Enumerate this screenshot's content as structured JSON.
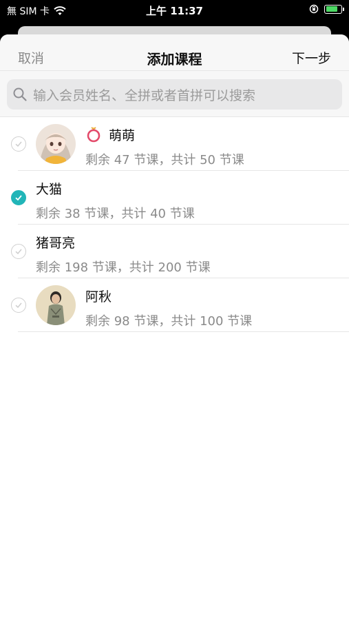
{
  "status_bar": {
    "carrier": "無 SIM 卡",
    "time": "上午 11:37"
  },
  "nav": {
    "cancel": "取消",
    "title": "添加课程",
    "next": "下一步"
  },
  "search": {
    "placeholder": "输入会员姓名、全拼或者首拼可以搜索"
  },
  "members": [
    {
      "name": "萌萌",
      "summary": "剩余 47 节课，共计 50 节课",
      "selected": false,
      "has_avatar": true,
      "name_icon": "ring-icon"
    },
    {
      "name": "大猫",
      "summary": "剩余 38 节课，共计 40 节课",
      "selected": true,
      "has_avatar": false
    },
    {
      "name": "猪哥亮",
      "summary": "剩余 198 节课，共计 200 节课",
      "selected": false,
      "has_avatar": false
    },
    {
      "name": "阿秋",
      "summary": "剩余 98 节课，共计 100 节课",
      "selected": false,
      "has_avatar": true
    }
  ],
  "colors": {
    "accent": "#21b5b8",
    "battery": "#4cd964"
  }
}
